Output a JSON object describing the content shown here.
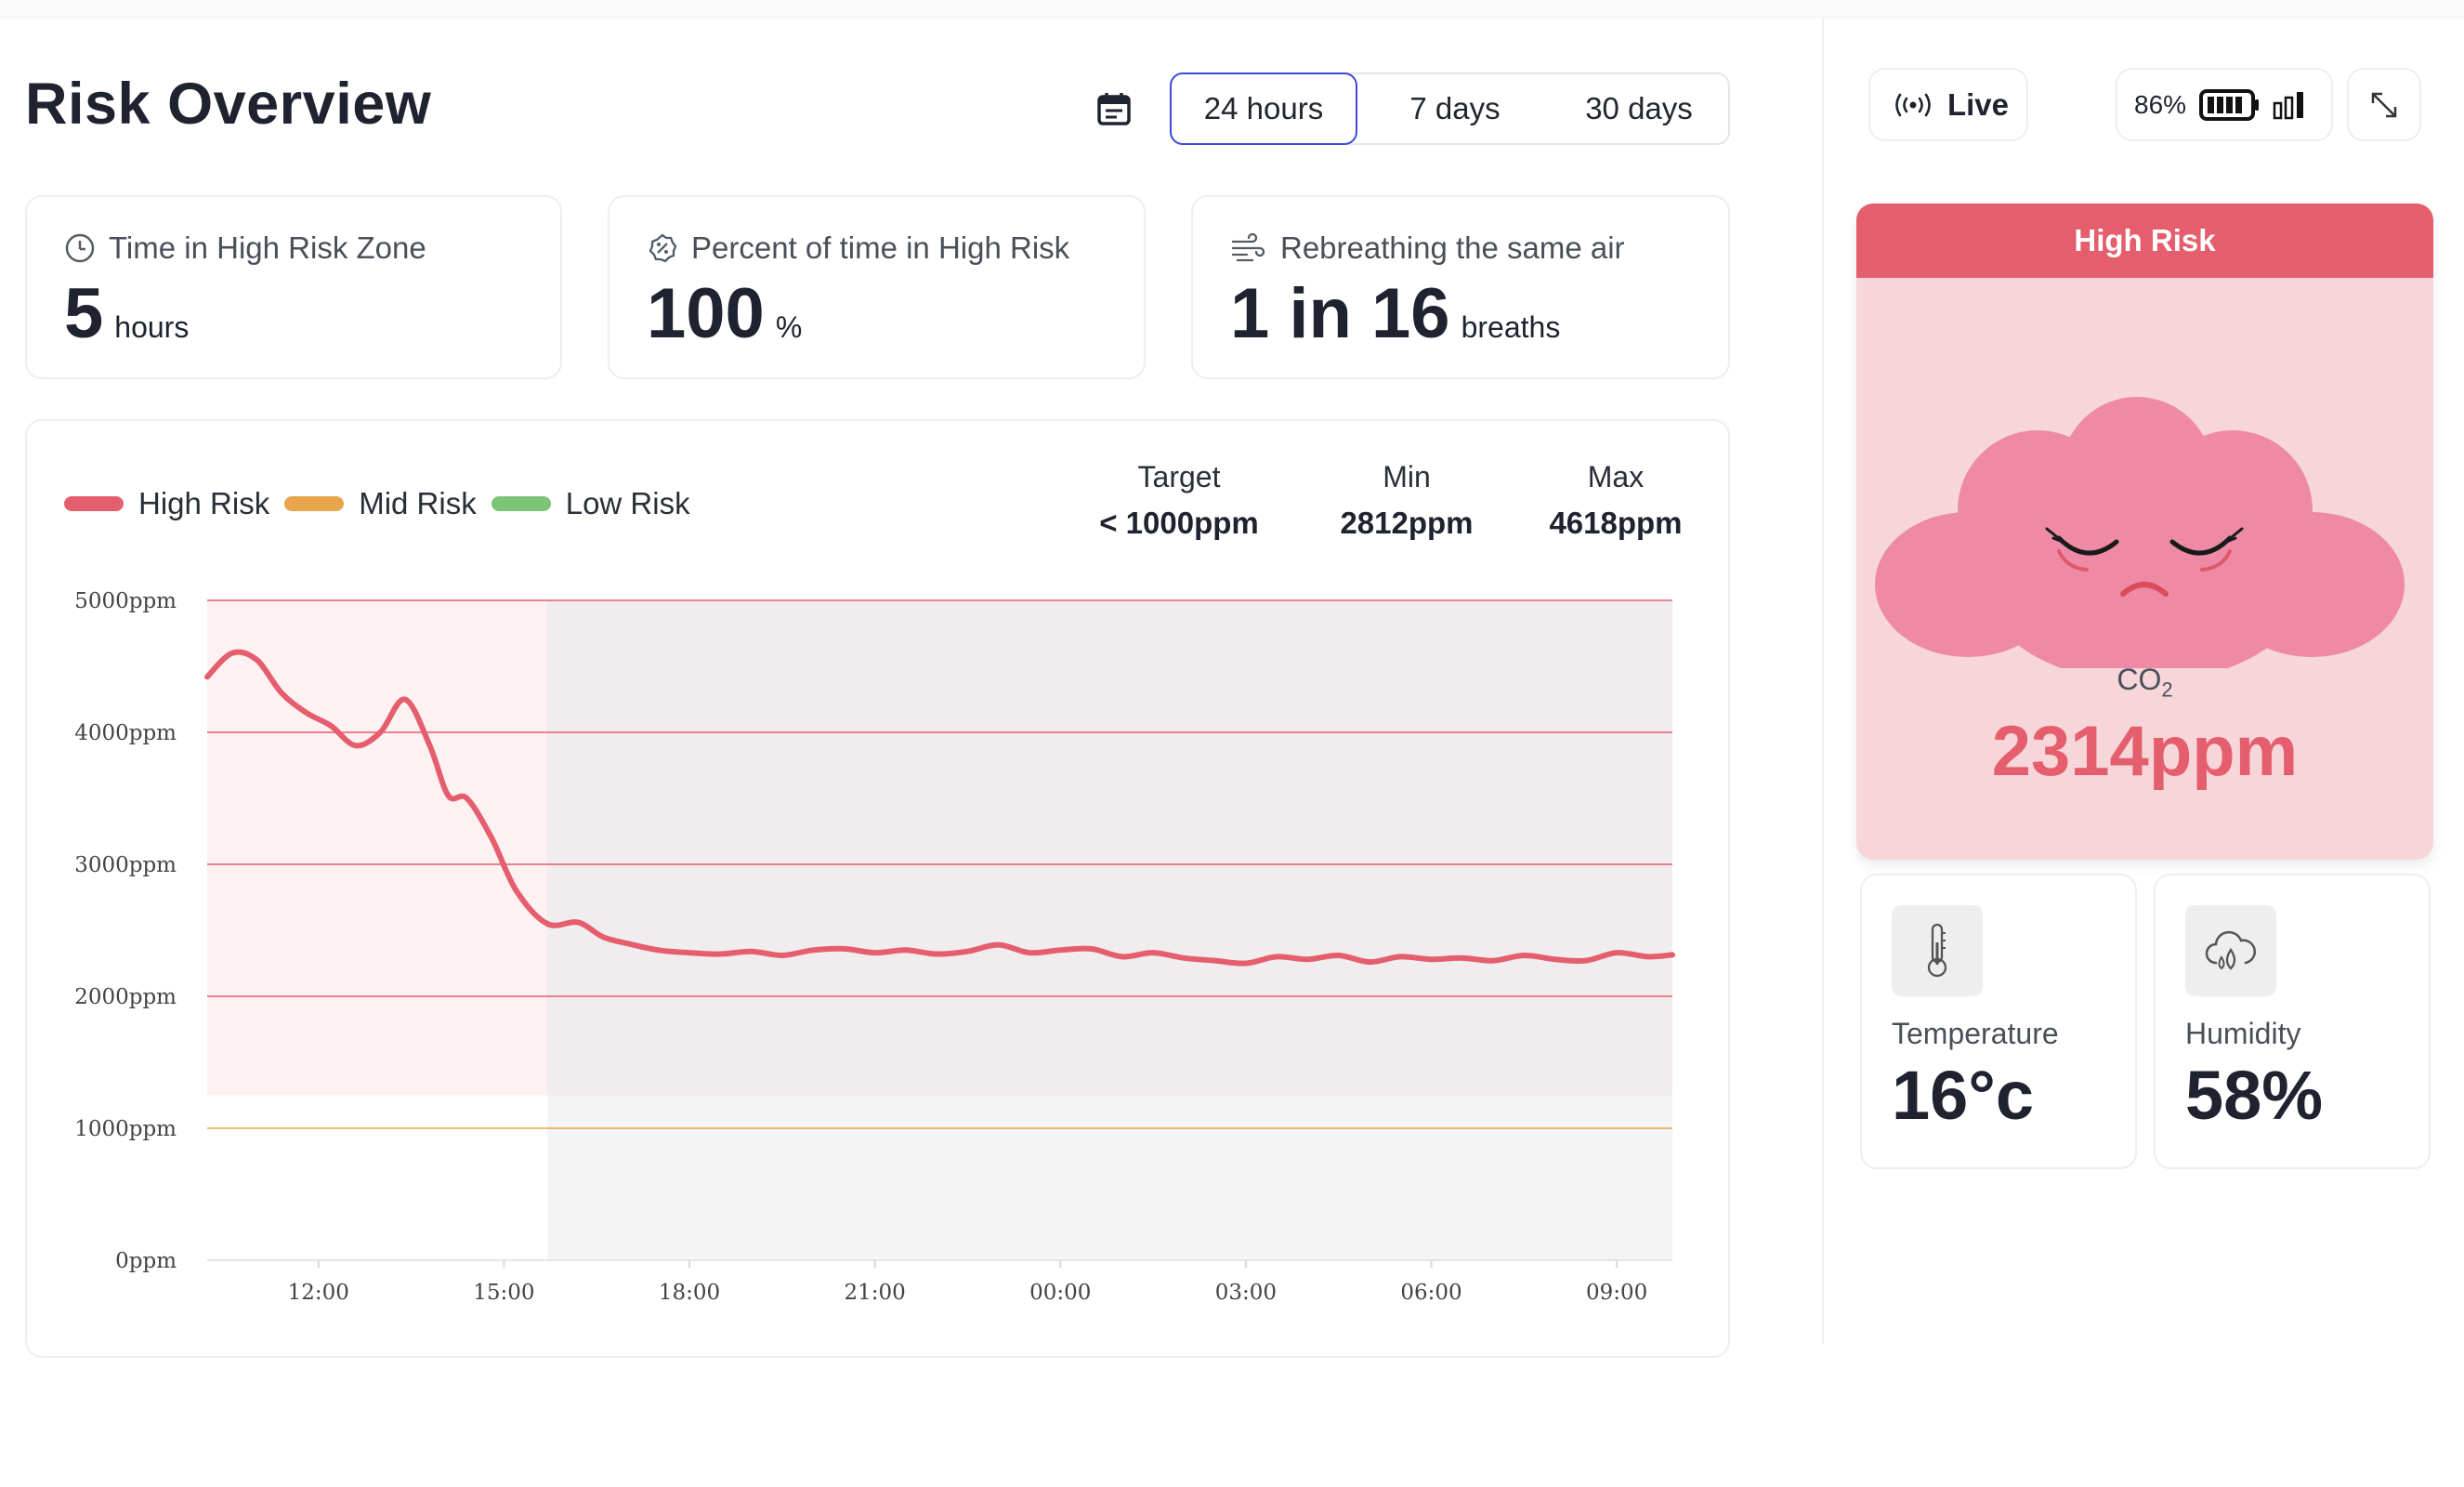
{
  "page_title": "Risk Overview",
  "time_range": {
    "options": [
      "24 hours",
      "7 days",
      "30 days"
    ],
    "selected": "24 hours"
  },
  "stats": [
    {
      "icon": "clock-icon",
      "label": "Time in High Risk Zone",
      "value": "5",
      "unit": "hours"
    },
    {
      "icon": "percent-badge-icon",
      "label": "Percent of time in High Risk",
      "value": "100",
      "unit": "%"
    },
    {
      "icon": "wind-icon",
      "label": "Rebreathing the same air",
      "value": "1 in 16",
      "unit": "breaths"
    }
  ],
  "legend": [
    {
      "label": "High Risk",
      "color": "#e55e6d"
    },
    {
      "label": "Mid Risk",
      "color": "#e8a54b"
    },
    {
      "label": "Low Risk",
      "color": "#7cc576"
    }
  ],
  "metrics": {
    "target": {
      "label": "Target",
      "value": "< 1000ppm"
    },
    "min": {
      "label": "Min",
      "value": "2812ppm"
    },
    "max": {
      "label": "Max",
      "value": "4618ppm"
    }
  },
  "chart_data": {
    "type": "line",
    "title": "",
    "xlabel": "",
    "ylabel": "",
    "ylim": [
      0,
      5000
    ],
    "y_ticks": [
      "0ppm",
      "1000ppm",
      "2000ppm",
      "3000ppm",
      "4000ppm",
      "5000ppm"
    ],
    "x_ticks": [
      "12:00",
      "15:00",
      "18:00",
      "21:00",
      "00:00",
      "03:00",
      "06:00",
      "09:00"
    ],
    "x_domain_hours": [
      10.2,
      33.9
    ],
    "zones": [
      {
        "name": "High Risk",
        "from": 2000,
        "to": 5000,
        "color": "#e55e6d"
      },
      {
        "name": "Mid Risk",
        "from": 1000,
        "to": 1000,
        "color": "#e8a54b"
      }
    ],
    "shaded_from_hours": 15.7,
    "series": [
      {
        "color": "#e55e6d",
        "x": [
          10.2,
          10.6,
          11.0,
          11.4,
          11.8,
          12.2,
          12.6,
          13.0,
          13.4,
          13.8,
          14.1,
          14.4,
          14.8,
          15.2,
          15.7,
          16.2,
          16.6,
          17.0,
          17.5,
          18.0,
          18.5,
          19.0,
          19.5,
          20.0,
          20.5,
          21.0,
          21.5,
          22.0,
          22.5,
          23.0,
          23.5,
          24.0,
          24.5,
          25.0,
          25.5,
          26.0,
          26.5,
          27.0,
          27.5,
          28.0,
          28.5,
          29.0,
          29.5,
          30.0,
          30.5,
          31.0,
          31.5,
          32.0,
          32.5,
          33.0,
          33.5,
          33.9
        ],
        "y": [
          4420,
          4600,
          4550,
          4300,
          4150,
          4050,
          3900,
          4000,
          4250,
          3900,
          3520,
          3500,
          3200,
          2800,
          2550,
          2560,
          2450,
          2400,
          2350,
          2330,
          2320,
          2340,
          2310,
          2350,
          2360,
          2330,
          2350,
          2320,
          2340,
          2390,
          2330,
          2350,
          2360,
          2300,
          2330,
          2290,
          2270,
          2250,
          2300,
          2280,
          2310,
          2260,
          2300,
          2280,
          2290,
          2270,
          2310,
          2280,
          2270,
          2330,
          2300,
          2314
        ]
      }
    ]
  },
  "status": {
    "live_label": "Live",
    "battery_percent": "86%",
    "risk_label": "High Risk",
    "co2_label": "CO",
    "co2_sub": "2",
    "co2_value": "2314ppm"
  },
  "conditions": [
    {
      "icon": "thermometer-icon",
      "label": "Temperature",
      "value": "16°c"
    },
    {
      "icon": "humidity-cloud-icon",
      "label": "Humidity",
      "value": "58%"
    }
  ]
}
